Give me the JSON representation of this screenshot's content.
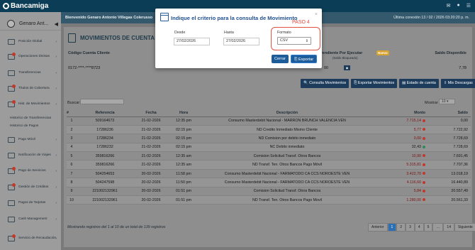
{
  "app": {
    "logo": "Bancamiga"
  },
  "topbar": {
    "icons": [
      "bell-icon",
      "user-icon",
      "menu-icon"
    ]
  },
  "sidebar": {
    "user_name": "Genaro Ant...",
    "items": [
      {
        "label": "Posición Global",
        "icon": "home-icon",
        "badge": false
      },
      {
        "label": "Operaciones Divisas",
        "icon": "exchange-icon",
        "badge": true
      },
      {
        "label": "Transferencias",
        "icon": "transfer-icon",
        "badge": false
      },
      {
        "label": "Títulos de Cobertura",
        "icon": "document-icon",
        "badge": true
      },
      {
        "label": "Hist. de Movimientos",
        "icon": "history-icon",
        "badge": true
      },
      {
        "label": "Pago Móvil",
        "icon": "phone-icon",
        "badge": false
      },
      {
        "label": "Notificación de Viajes",
        "icon": "plane-icon",
        "badge": false
      },
      {
        "label": "Pago de Servicios",
        "icon": "service-icon",
        "badge": true
      },
      {
        "label": "Gestión de Créditos",
        "icon": "credit-icon",
        "badge": true
      },
      {
        "label": "Pagos de Tarjetas",
        "icon": "card-icon",
        "badge": false
      },
      {
        "label": "Cash Management",
        "icon": "cash-icon",
        "badge": false
      },
      {
        "label": "Servicio de Recaudación",
        "icon": "collection-icon",
        "badge": true
      }
    ],
    "sub_items": [
      "Historico de Transferencias",
      "Historico de Pagos"
    ]
  },
  "header": {
    "welcome": "Bienvenido Genaro Antonio Villegas Colerusso",
    "last_login": "Última conexión 13 / 02 / 2026 03:20:20 p. m."
  },
  "page": {
    "title": "MOVIMIENTOS DE CUENTA C",
    "account_cols": [
      "Código Cuenta Cliente",
      "Pendiente Por Ejecutar",
      "Saldo Disponible"
    ],
    "pending_badge": "Nuevo",
    "pending_sub": "(Saldo Bloqueado)",
    "account": {
      "code": "0172-****-****8723",
      "pending": "00",
      "balance": "7,78"
    },
    "buttons": [
      "Consulta Movimientos",
      "Exportar Movimientos",
      "Estado de cuenta",
      "Mis Descargas"
    ],
    "search_label": "Buscar:",
    "show_label": "Mostrar",
    "show_value": "10",
    "columns": [
      "#",
      "Referencia",
      "Fecha",
      "Hora",
      "Descripción",
      "Monto",
      "Saldo"
    ],
    "rows": [
      {
        "n": "1",
        "ref": "509164673",
        "fecha": "21-02-2026",
        "hora": "12:35 pm",
        "desc": "Consumo Masterdebit Nacional - MARRON BRUNCH VALENCIA VEN",
        "monto": "7.715,14",
        "sign": "neg",
        "saldo": "0,00"
      },
      {
        "n": "2",
        "ref": "17286236",
        "fecha": "21-02-2026",
        "hora": "02:15 pm",
        "desc": "ND Credito Inmediato Mismo Cliente",
        "monto": "5,77",
        "sign": "neg",
        "saldo": "7.722,92"
      },
      {
        "n": "3",
        "ref": "17286234",
        "fecha": "21-02-2026",
        "hora": "02:15 pm",
        "desc": "ND Comision por debito inmediato",
        "monto": "0,00",
        "sign": "neg",
        "saldo": "7.728,69"
      },
      {
        "n": "4",
        "ref": "17286232",
        "fecha": "21-02-2026",
        "hora": "02:15 pm",
        "desc": "NC Debito inmediato",
        "monto": "32,43",
        "sign": "pos",
        "saldo": "7.728,69"
      },
      {
        "n": "5",
        "ref": "359816266",
        "fecha": "21-02-2026",
        "hora": "12:35 am",
        "desc": "Comision Solicitud Transf. Otros Bancos",
        "monto": "10,90",
        "sign": "neg",
        "saldo": "7.691,45"
      },
      {
        "n": "6",
        "ref": "359816266",
        "fecha": "21-02-2026",
        "hora": "12:35 am",
        "desc": "ND Transf. Ten. Otros Bancos Pago Móvil",
        "monto": "5.315,81",
        "sign": "neg",
        "saldo": "7.707,36"
      },
      {
        "n": "7",
        "ref": "504254653",
        "fecha": "20-02-2026",
        "hora": "11:58 pm",
        "desc": "Consumo Masterdebit Nacional - FARMATODO CA CCS NOROESTE VEN",
        "monto": "3.422,70",
        "sign": "neg",
        "saldo": "13.018,19"
      },
      {
        "n": "8",
        "ref": "504247598",
        "fecha": "20-02-2026",
        "hora": "11:50 pm",
        "desc": "Consumo Masterdebit Nacional - FARMATODO CA CCS NOROESTE VEN",
        "monto": "4.116,60",
        "sign": "neg",
        "saldo": "16.440,89"
      },
      {
        "n": "9",
        "ref": "221002132961",
        "fecha": "20-02-2026",
        "hora": "01:51 pm",
        "desc": "Comision Solicitud Transf. Otros Bancos",
        "monto": "5,84",
        "sign": "neg",
        "saldo": "20.557,49"
      },
      {
        "n": "10",
        "ref": "221002132961",
        "fecha": "20-02-2026",
        "hora": "01:51 pm",
        "desc": "ND Transf. Ten. Otros Bancos Pago Movil",
        "monto": "1.280,00",
        "sign": "neg",
        "saldo": "20.561,33"
      }
    ],
    "footer_info": "Mostrando registros del 1 al 10 de un total de 139 registros",
    "pager": [
      "Anterior",
      "1",
      "2",
      "3",
      "4",
      "5",
      "…",
      "14",
      "Siguiente"
    ]
  },
  "modal": {
    "title": "Indique el criterio para la consulta de Movimiento",
    "step_label": "PASO 4",
    "desde_label": "Desde",
    "desde_value": "27/02/2026",
    "hasta_label": "Hasta",
    "hasta_value": "27/02/2026",
    "format_label": "Formato",
    "format_value": "CSV",
    "cerrar": "Cerrar",
    "exportar": "Exportar",
    "colors": {
      "title": "#1f4f91",
      "highlight": "#e0523f",
      "button": "#1c5c9a"
    }
  }
}
